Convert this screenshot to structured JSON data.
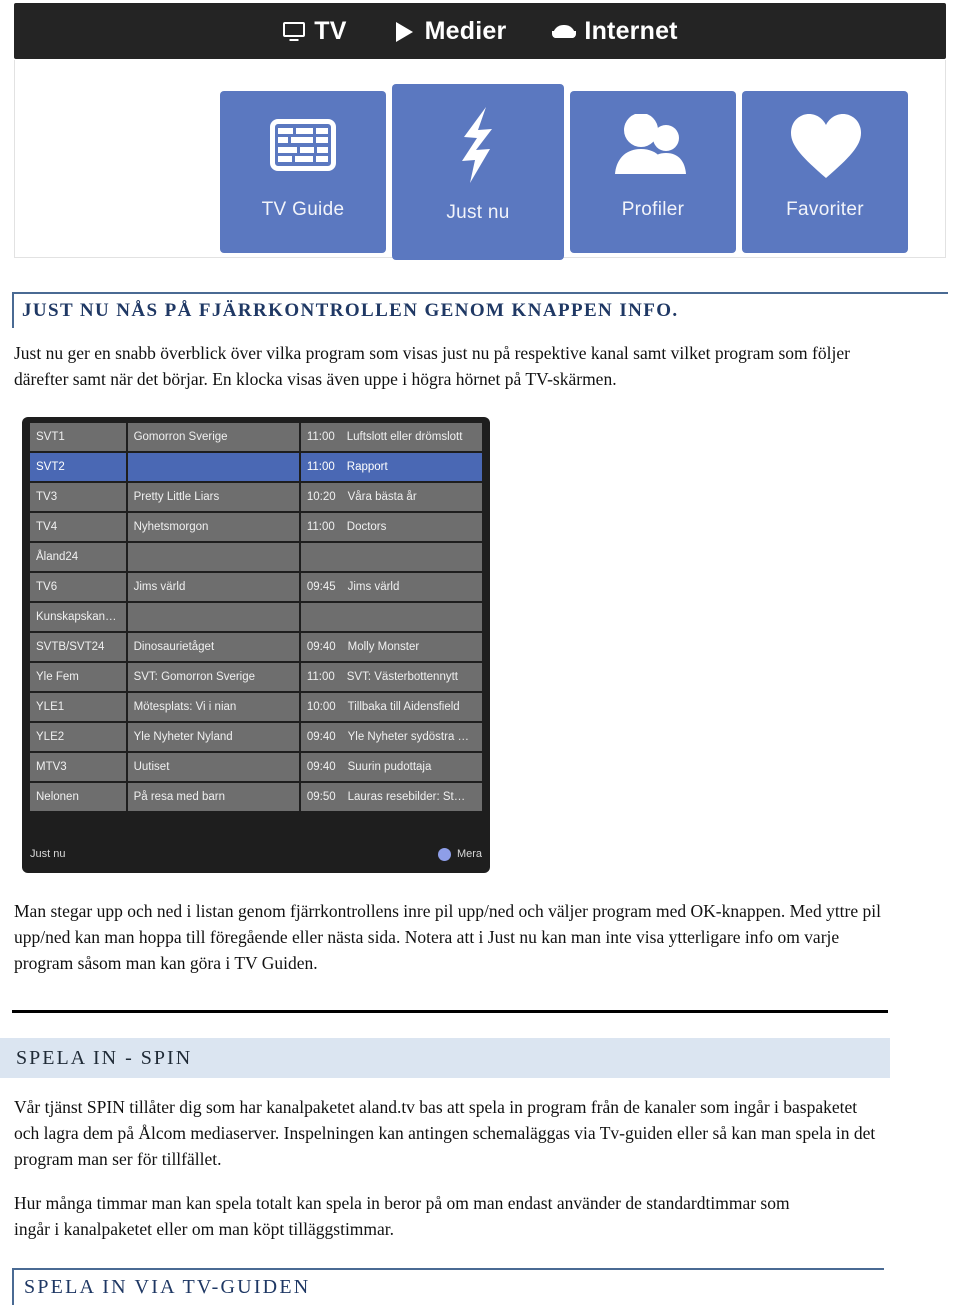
{
  "tv_ui": {
    "topbar": [
      {
        "label": "TV",
        "icon": "monitor-icon"
      },
      {
        "label": "Medier",
        "icon": "play-icon"
      },
      {
        "label": "Internet",
        "icon": "cloud-icon"
      }
    ],
    "tiles": [
      {
        "label": "TV Guide",
        "icon": "grid-icon",
        "selected": false
      },
      {
        "label": "Just nu",
        "icon": "lightning-bolt-icon",
        "selected": true
      },
      {
        "label": "Profiler",
        "icon": "people-icon",
        "selected": false
      },
      {
        "label": "Favoriter",
        "icon": "heart-icon",
        "selected": false
      }
    ],
    "accent_color": "#5b78c0",
    "topbar_color": "#242424"
  },
  "doc": {
    "heading_info": "JUST NU NÅS PÅ FJÄRRKONTROLLEN GENOM KNAPPEN INFO.",
    "para_intro": "Just nu ger en snabb överblick över vilka program som visas just nu på respektive kanal samt vilket program som följer därefter samt när det börjar. En klocka visas även uppe i högra hörnet på TV-skärmen.",
    "para_mid": "Man stegar upp och ned i listan genom fjärrkontrollens inre pil upp/ned och väljer program med OK-knappen. Med yttre pil upp/ned kan man hoppa till föregående eller nästa sida. Notera att i Just nu kan man inte visa ytterligare info om varje program såsom man kan göra i TV Guiden.",
    "heading_spin": "SPELA IN - SPIN",
    "para_spin": "Vår tjänst SPIN tillåter dig som har kanalpaketet aland.tv bas att spela in program från de kanaler som ingår i baspaketet och lagra dem på Ålcom mediaserver. Inspelningen kan antingen schemaläggas via Tv-guiden eller så kan man spela in det program man ser för tillfället.",
    "para_hours": "Hur många timmar man kan spela totalt kan spela in beror på om man endast använder de standardtimmar som ingår i kanalpaketet eller om man köpt tilläggstimmar.",
    "heading_tvguiden": "SPELA IN VIA TV-GUIDEN",
    "heading_color": "#1f3864",
    "spin_heading_bg": "#dbe5f1"
  },
  "guide": {
    "footer_left": "Just nu",
    "footer_right": "Mera",
    "selected_row_index": 1,
    "highlight_color": "#4a68b4",
    "row_color": "#6e6e6e",
    "rows": [
      {
        "channel": "SVT1",
        "now": "Gomorron Sverige",
        "time": "11:00",
        "next": "Luftslott eller drömslott"
      },
      {
        "channel": "SVT2",
        "now": "",
        "time": "11:00",
        "next": "Rapport"
      },
      {
        "channel": "TV3",
        "now": "Pretty Little Liars",
        "time": "10:20",
        "next": "Våra bästa år"
      },
      {
        "channel": "TV4",
        "now": "Nyhetsmorgon",
        "time": "11:00",
        "next": "Doctors"
      },
      {
        "channel": "Åland24",
        "now": "",
        "time": "",
        "next": ""
      },
      {
        "channel": "TV6",
        "now": "Jims värld",
        "time": "09:45",
        "next": "Jims värld"
      },
      {
        "channel": "Kunskapskan…",
        "now": "",
        "time": "",
        "next": ""
      },
      {
        "channel": "SVTB/SVT24",
        "now": "Dinosaurietåget",
        "time": "09:40",
        "next": "Molly Monster"
      },
      {
        "channel": "Yle Fem",
        "now": "SVT: Gomorron Sverige",
        "time": "11:00",
        "next": "SVT: Västerbottennytt"
      },
      {
        "channel": "YLE1",
        "now": "Mötesplats: Vi i nian",
        "time": "10:00",
        "next": "Tillbaka till Aidensfield"
      },
      {
        "channel": "YLE2",
        "now": "Yle Nyheter Nyland",
        "time": "09:40",
        "next": "Yle Nyheter sydöstra …"
      },
      {
        "channel": "MTV3",
        "now": "Uutiset",
        "time": "09:40",
        "next": "Suurin pudottaja"
      },
      {
        "channel": "Nelonen",
        "now": "På resa med barn",
        "time": "09:50",
        "next": "Lauras resebilder: St…"
      }
    ]
  }
}
